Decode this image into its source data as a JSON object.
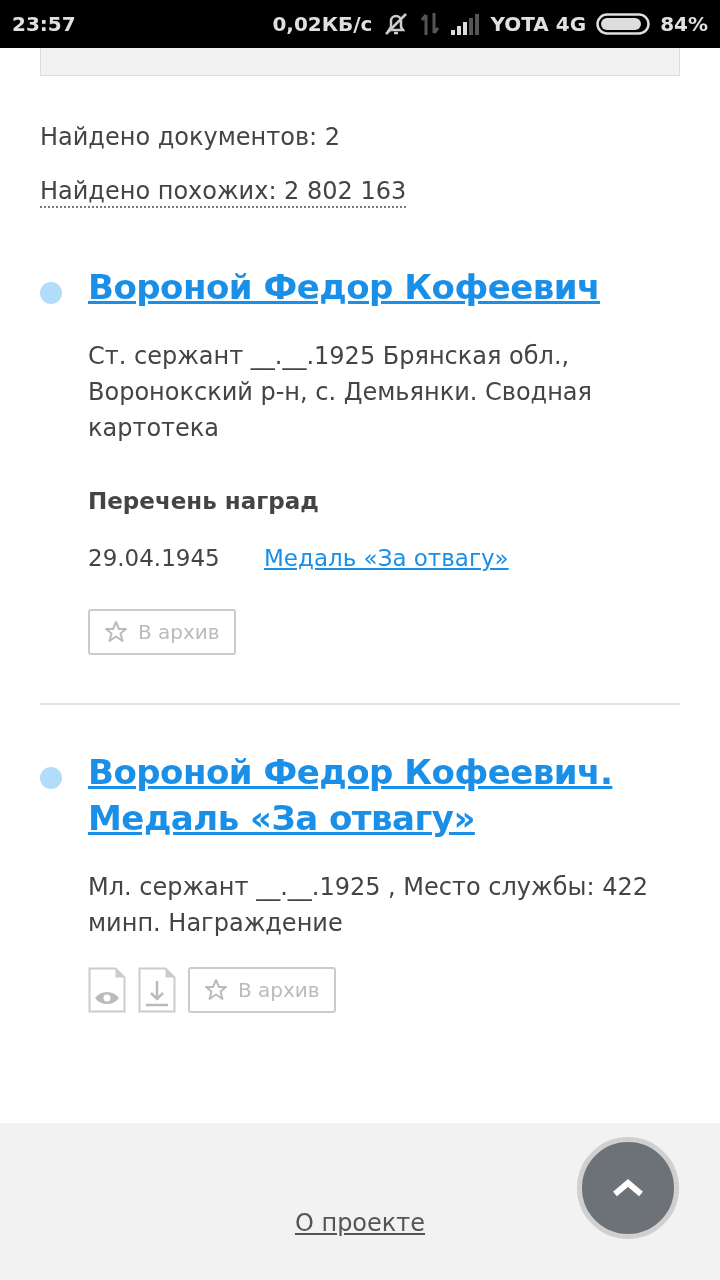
{
  "status_bar": {
    "time": "23:57",
    "speed": "0,02КБ/с",
    "carrier": "YOTA 4G",
    "battery": "84%"
  },
  "found_documents": "Найдено документов: 2",
  "found_similar": "Найдено похожих: 2 802 163",
  "results": [
    {
      "title": "Вороной Федор Кофеевич",
      "description": "Ст. сержант __.__.1925 Брянская обл., Воронокский р-н, с. Демьянки. Сводная картотека",
      "awards_heading": "Перечень наград",
      "awards": [
        {
          "date": "29.04.1945",
          "name": "Медаль «За отвагу»"
        }
      ],
      "actions": [
        {
          "kind": "archive",
          "label": "В архив"
        }
      ]
    },
    {
      "title": "Вороной Федор Кофеевич. Медаль «За отвагу»",
      "description": "Мл. сержант __.__.1925 , Место службы: 422 минп. Награждение",
      "actions": [
        {
          "kind": "view"
        },
        {
          "kind": "download"
        },
        {
          "kind": "archive",
          "label": "В архив"
        }
      ]
    }
  ],
  "footer": {
    "link": "О проекте"
  }
}
